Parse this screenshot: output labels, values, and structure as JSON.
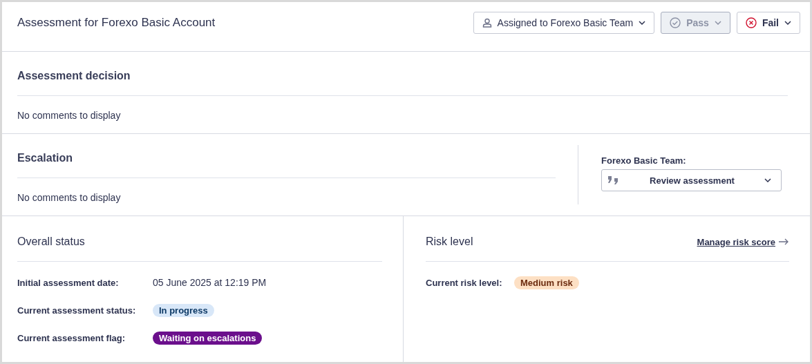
{
  "header": {
    "title": "Assessment for Forexo Basic Account",
    "buttons": [
      {
        "kind": "assign",
        "label": "Assigned to Forexo Basic Team",
        "disabled": false
      },
      {
        "kind": "pass",
        "label": "Pass",
        "disabled": true
      },
      {
        "kind": "fail",
        "label": "Fail",
        "disabled": false
      }
    ]
  },
  "decision": {
    "title": "Assessment decision",
    "empty_text": "No comments to display"
  },
  "escalation": {
    "title": "Escalation",
    "empty_text": "No comments to display",
    "team_label": "Forexo Basic Team:",
    "action": "Review assessment"
  },
  "overall_status": {
    "title": "Overall status",
    "rows": [
      {
        "label": "Initial assessment date:",
        "value": "05 June 2025 at 12:19 PM",
        "kind": "text"
      },
      {
        "label": "Current assessment status:",
        "value": "In progress",
        "kind": "info"
      },
      {
        "label": "Current assessment flag:",
        "value": "Waiting on escalations",
        "kind": "flag"
      }
    ]
  },
  "risk": {
    "title": "Risk level",
    "link": "Manage risk score",
    "rows": [
      {
        "label": "Current risk level:",
        "value": "Medium risk",
        "kind": "warning"
      }
    ]
  }
}
